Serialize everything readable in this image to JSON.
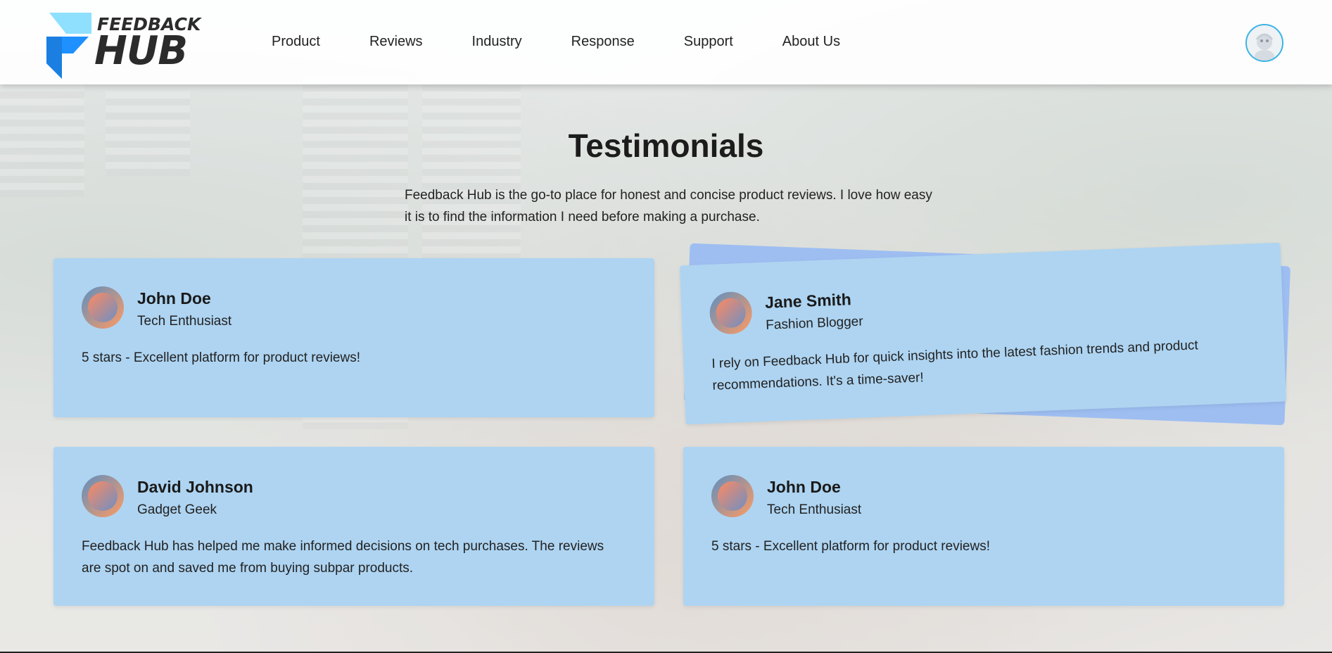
{
  "brand": {
    "top": "FEEDBACK",
    "bottom": "HUB"
  },
  "nav": [
    {
      "label": "Product"
    },
    {
      "label": "Reviews"
    },
    {
      "label": "Industry"
    },
    {
      "label": "Response"
    },
    {
      "label": "Support"
    },
    {
      "label": "About Us"
    }
  ],
  "page": {
    "title": "Testimonials",
    "intro": "Feedback Hub is the go-to place for honest and concise product reviews. I love how easy it is to find the information I need before making a purchase."
  },
  "testimonials": [
    {
      "name": "John Doe",
      "role": "Tech Enthusiast",
      "text": "5 stars - Excellent platform for product reviews!"
    },
    {
      "name": "Jane Smith",
      "role": "Fashion Blogger",
      "text": "I rely on Feedback Hub for quick insights into the latest fashion trends and product recommendations. It's a time-saver!"
    },
    {
      "name": "David Johnson",
      "role": "Gadget Geek",
      "text": "Feedback Hub has helped me make informed decisions on tech purchases. The reviews are spot on and saved me from buying subpar products."
    },
    {
      "name": "John Doe",
      "role": "Tech Enthusiast",
      "text": "5 stars - Excellent platform for product reviews!"
    }
  ],
  "colors": {
    "card": "#aed4f1",
    "card_back": "#9ebef2",
    "logo_blue": "#1e90ff",
    "logo_light": "#7fd6ff",
    "avatar_ring": "#3bb3e6"
  },
  "icons": {
    "user_avatar": "user-avatar-icon",
    "testimonial_avatar": "gradient-circle-avatar"
  }
}
